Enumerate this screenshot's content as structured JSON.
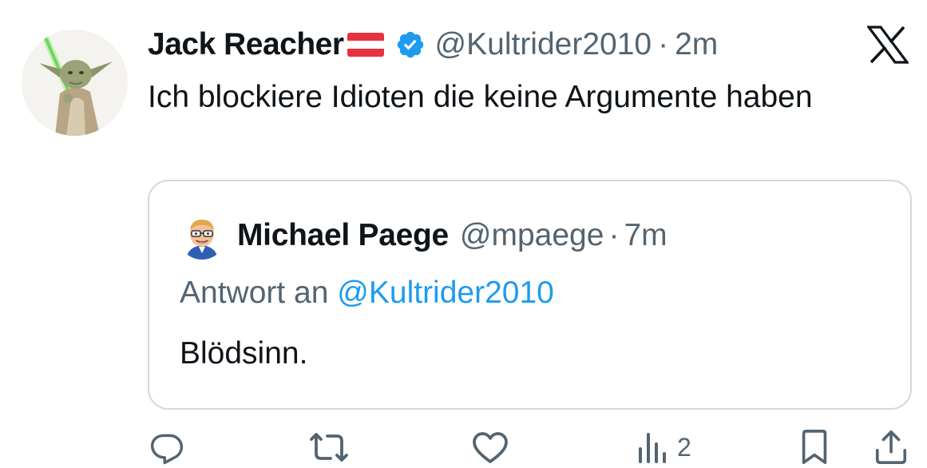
{
  "tweet": {
    "author": {
      "display_name": "Jack Reacher",
      "flag_icon": "austria-flag-icon",
      "verified_icon": "verified-badge-icon",
      "handle": "@Kultrider2010",
      "separator": "·",
      "time": "2m"
    },
    "text": "Ich blockiere Idioten die keine Argumente haben",
    "platform_icon": "x-logo-icon",
    "quote": {
      "author": {
        "display_name": "Michael Paege",
        "handle": "@mpaege",
        "separator": "·",
        "time": "7m"
      },
      "reply_prefix": "Antwort an",
      "reply_mention": "@Kultrider2010",
      "text": "Blödsinn."
    },
    "actions": {
      "reply_icon": "reply-icon",
      "retweet_icon": "retweet-icon",
      "like_icon": "like-icon",
      "views_icon": "views-icon",
      "views_count": "2",
      "bookmark_icon": "bookmark-icon",
      "share_icon": "share-icon"
    }
  },
  "colors": {
    "text_primary": "#0f1419",
    "text_secondary": "#536471",
    "accent_blue": "#1d9bf0",
    "border": "#cfd9de"
  }
}
